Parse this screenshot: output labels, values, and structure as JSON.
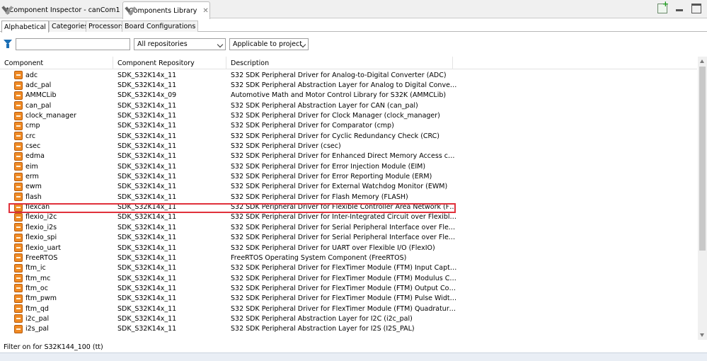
{
  "editor_tabs": [
    {
      "label": "*Component Inspector - canCom1"
    },
    {
      "label": "Components Library"
    }
  ],
  "close_glyph": "✕",
  "view_tabs": [
    {
      "label": "Alphabetical"
    },
    {
      "label": "Categories"
    },
    {
      "label": "Processors"
    },
    {
      "label": "Board Configurations"
    }
  ],
  "filter": {
    "search_value": "",
    "repositories_selected": "All repositories",
    "applicability_selected": "Applicable to project"
  },
  "columns": {
    "component": "Component",
    "repository": "Component Repository",
    "description": "Description"
  },
  "rows": [
    {
      "name": "adc",
      "repo": "SDK_S32K14x_11",
      "desc": "S32 SDK Peripheral Driver for Analog-to-Digital Converter (ADC)"
    },
    {
      "name": "adc_pal",
      "repo": "SDK_S32K14x_11",
      "desc": "S32 SDK Peripheral Abstraction Layer for Analog to Digital Converter (AD..."
    },
    {
      "name": "AMMCLib",
      "repo": "SDK_S32K14x_09",
      "desc": "Automotive Math and Motor Control Library for S32K (AMMCLib)"
    },
    {
      "name": "can_pal",
      "repo": "SDK_S32K14x_11",
      "desc": "S32 SDK Peripheral Abstraction Layer for CAN (can_pal)"
    },
    {
      "name": "clock_manager",
      "repo": "SDK_S32K14x_11",
      "desc": "S32 SDK Peripheral Driver for Clock Manager (clock_manager)"
    },
    {
      "name": "cmp",
      "repo": "SDK_S32K14x_11",
      "desc": "S32 SDK Peripheral Driver for Comparator (cmp)"
    },
    {
      "name": "crc",
      "repo": "SDK_S32K14x_11",
      "desc": "S32 SDK Peripheral Driver for Cyclic Redundancy Check (CRC)"
    },
    {
      "name": "csec",
      "repo": "SDK_S32K14x_11",
      "desc": "S32 SDK Peripheral Driver (csec)"
    },
    {
      "name": "edma",
      "repo": "SDK_S32K14x_11",
      "desc": "S32 SDK Peripheral Driver for Enhanced Direct Memory Access controller ..."
    },
    {
      "name": "eim",
      "repo": "SDK_S32K14x_11",
      "desc": "S32 SDK Peripheral Driver for Error Injection Module (EIM)"
    },
    {
      "name": "erm",
      "repo": "SDK_S32K14x_11",
      "desc": "S32 SDK Peripheral Driver for Error Reporting Module (ERM)"
    },
    {
      "name": "ewm",
      "repo": "SDK_S32K14x_11",
      "desc": "S32 SDK Peripheral Driver for External Watchdog Monitor (EWM)"
    },
    {
      "name": "flash",
      "repo": "SDK_S32K14x_11",
      "desc": "S32 SDK Peripheral Driver for Flash Memory (FLASH)"
    },
    {
      "name": "flexcan",
      "repo": "SDK_S32K14x_11",
      "desc": "S32 SDK Peripheral Driver for Flexible Controller Area Network (FlexCAN)"
    },
    {
      "name": "flexio_i2c",
      "repo": "SDK_S32K14x_11",
      "desc": "S32 SDK Peripheral Driver for Inter-Integrated Circuit over Flexible I/O (Fl..."
    },
    {
      "name": "flexio_i2s",
      "repo": "SDK_S32K14x_11",
      "desc": "S32 SDK Peripheral Driver for Serial Peripheral Interface over Flexible I/O (..."
    },
    {
      "name": "flexio_spi",
      "repo": "SDK_S32K14x_11",
      "desc": "S32 SDK Peripheral Driver for Serial Peripheral Interface over Flexible I/O (..."
    },
    {
      "name": "flexio_uart",
      "repo": "SDK_S32K14x_11",
      "desc": "S32 SDK Peripheral Driver for UART over Flexible I/O (FlexIO)"
    },
    {
      "name": "FreeRTOS",
      "repo": "SDK_S32K14x_11",
      "desc": "FreeRTOS Operating System Component (FreeRTOS)"
    },
    {
      "name": "ftm_ic",
      "repo": "SDK_S32K14x_11",
      "desc": "S32 SDK Peripheral Driver for FlexTimer Module (FTM) Input Capture"
    },
    {
      "name": "ftm_mc",
      "repo": "SDK_S32K14x_11",
      "desc": "S32 SDK Peripheral Driver for FlexTimer Module (FTM) Modulus Counter"
    },
    {
      "name": "ftm_oc",
      "repo": "SDK_S32K14x_11",
      "desc": "S32 SDK Peripheral Driver for FlexTimer Module (FTM) Output Compare"
    },
    {
      "name": "ftm_pwm",
      "repo": "SDK_S32K14x_11",
      "desc": "S32 SDK Peripheral Driver for FlexTimer Module (FTM) Pulse Width Mod..."
    },
    {
      "name": "ftm_qd",
      "repo": "SDK_S32K14x_11",
      "desc": "S32 SDK Peripheral Driver for FlexTimer Module (FTM) Quadrature Decod..."
    },
    {
      "name": "i2c_pal",
      "repo": "SDK_S32K14x_11",
      "desc": "S32 SDK Peripheral Abstraction Layer for I2C (i2c_pal)"
    },
    {
      "name": "i2s_pal",
      "repo": "SDK_S32K14x_11",
      "desc": "S32 SDK Peripheral Abstraction Layer for I2S (I2S_PAL)"
    }
  ],
  "status": {
    "text": "Filter on for S32K144_100 (tt)"
  },
  "colors": {
    "highlight": "#e0313b",
    "icon": "#f08a24"
  }
}
